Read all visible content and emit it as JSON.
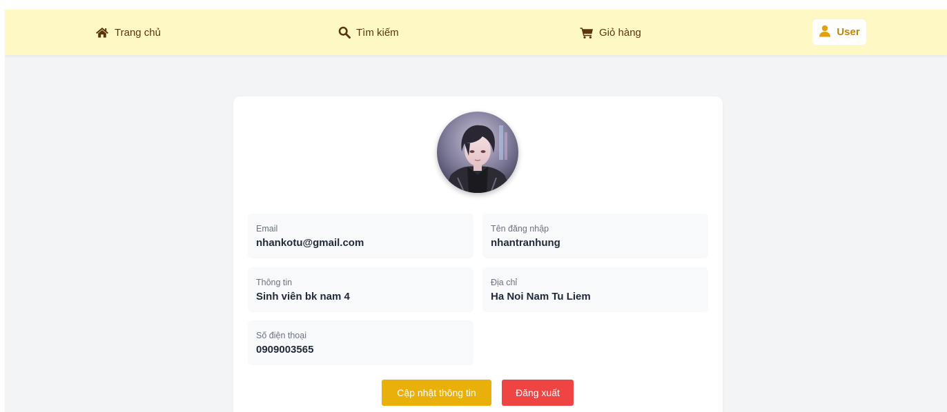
{
  "nav": {
    "home_label": "Trang chủ",
    "search_label": "Tìm kiếm",
    "cart_label": "Giỏ hàng",
    "user_label": "User"
  },
  "profile": {
    "fields": [
      {
        "label": "Email",
        "value": "nhankotu@gmail.com"
      },
      {
        "label": "Tên đăng nhập",
        "value": "nhantranhung"
      },
      {
        "label": "Thông tin",
        "value": "Sinh viên bk nam 4"
      },
      {
        "label": "Địa chỉ",
        "value": "Ha Noi Nam Tu Liem"
      },
      {
        "label": "Số điện thoại",
        "value": "0909003565"
      }
    ],
    "update_button": "Cập nhật thông tin",
    "logout_button": "Đăng xuất"
  },
  "colors": {
    "navbar_bg": "#fef8c4",
    "nav_text": "#5b3410",
    "user_accent": "#b8860b",
    "update_button": "#e8b008",
    "logout_button": "#ef4444",
    "page_bg": "#f3f4f6"
  },
  "icons": {
    "home": "home-icon",
    "search": "search-icon",
    "cart": "cart-icon",
    "user": "user-icon"
  }
}
